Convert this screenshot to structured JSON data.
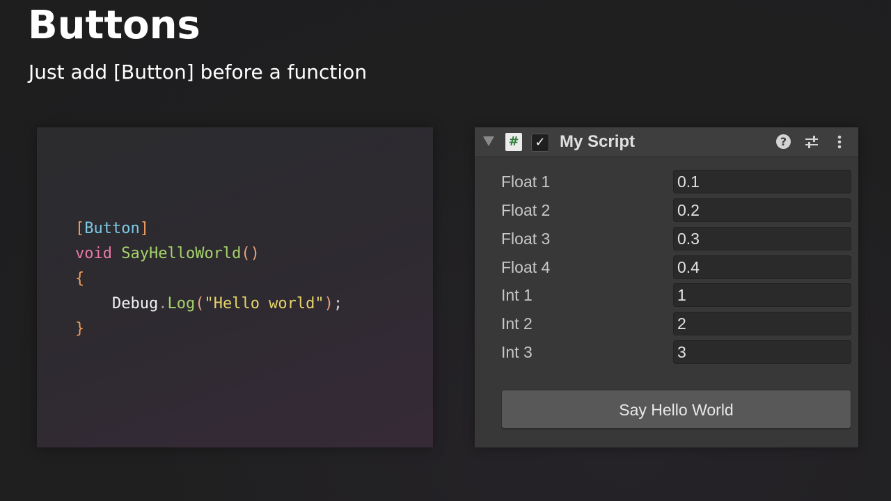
{
  "slide": {
    "title": "Buttons",
    "subtitle": "Just add [Button] before a function"
  },
  "code": {
    "line1": {
      "open": "[",
      "attr": "Button",
      "close": "]"
    },
    "line2": {
      "keyword": "void",
      "func": "SayHelloWorld",
      "parens": "()"
    },
    "line3": {
      "brace": "{"
    },
    "line4": {
      "obj": "Debug",
      "dot": ".",
      "method": "Log",
      "open": "(",
      "string": "\"Hello world\"",
      "close": ")",
      "semi": ";"
    },
    "line5": {
      "brace": "}"
    }
  },
  "inspector": {
    "component_title": "My Script",
    "script_icon_glyph": "#",
    "enabled_glyph": "✓",
    "help_glyph": "?",
    "icons": {
      "foldout": "foldout-triangle-icon",
      "script": "csharp-script-icon",
      "help": "help-icon",
      "presets": "presets-sliders-icon",
      "menu": "kebab-menu-icon"
    },
    "fields": [
      {
        "label": "Float 1",
        "value": "0.1"
      },
      {
        "label": "Float 2",
        "value": "0.2"
      },
      {
        "label": "Float 3",
        "value": "0.3"
      },
      {
        "label": "Float 4",
        "value": "0.4"
      },
      {
        "label": "Int 1",
        "value": "1"
      },
      {
        "label": "Int 2",
        "value": "2"
      },
      {
        "label": "Int 3",
        "value": "3"
      }
    ],
    "button_label": "Say Hello World"
  },
  "colors": {
    "background": "#1f1f20",
    "inspector_bg": "#383838",
    "field_bg": "#2a2a2a",
    "button_bg": "#585858",
    "code_keyword": "#e87aa6",
    "code_function": "#a6d36a",
    "code_attribute": "#7cc9e6",
    "code_string": "#e6d46a",
    "code_bracket": "#ee9d5c"
  }
}
